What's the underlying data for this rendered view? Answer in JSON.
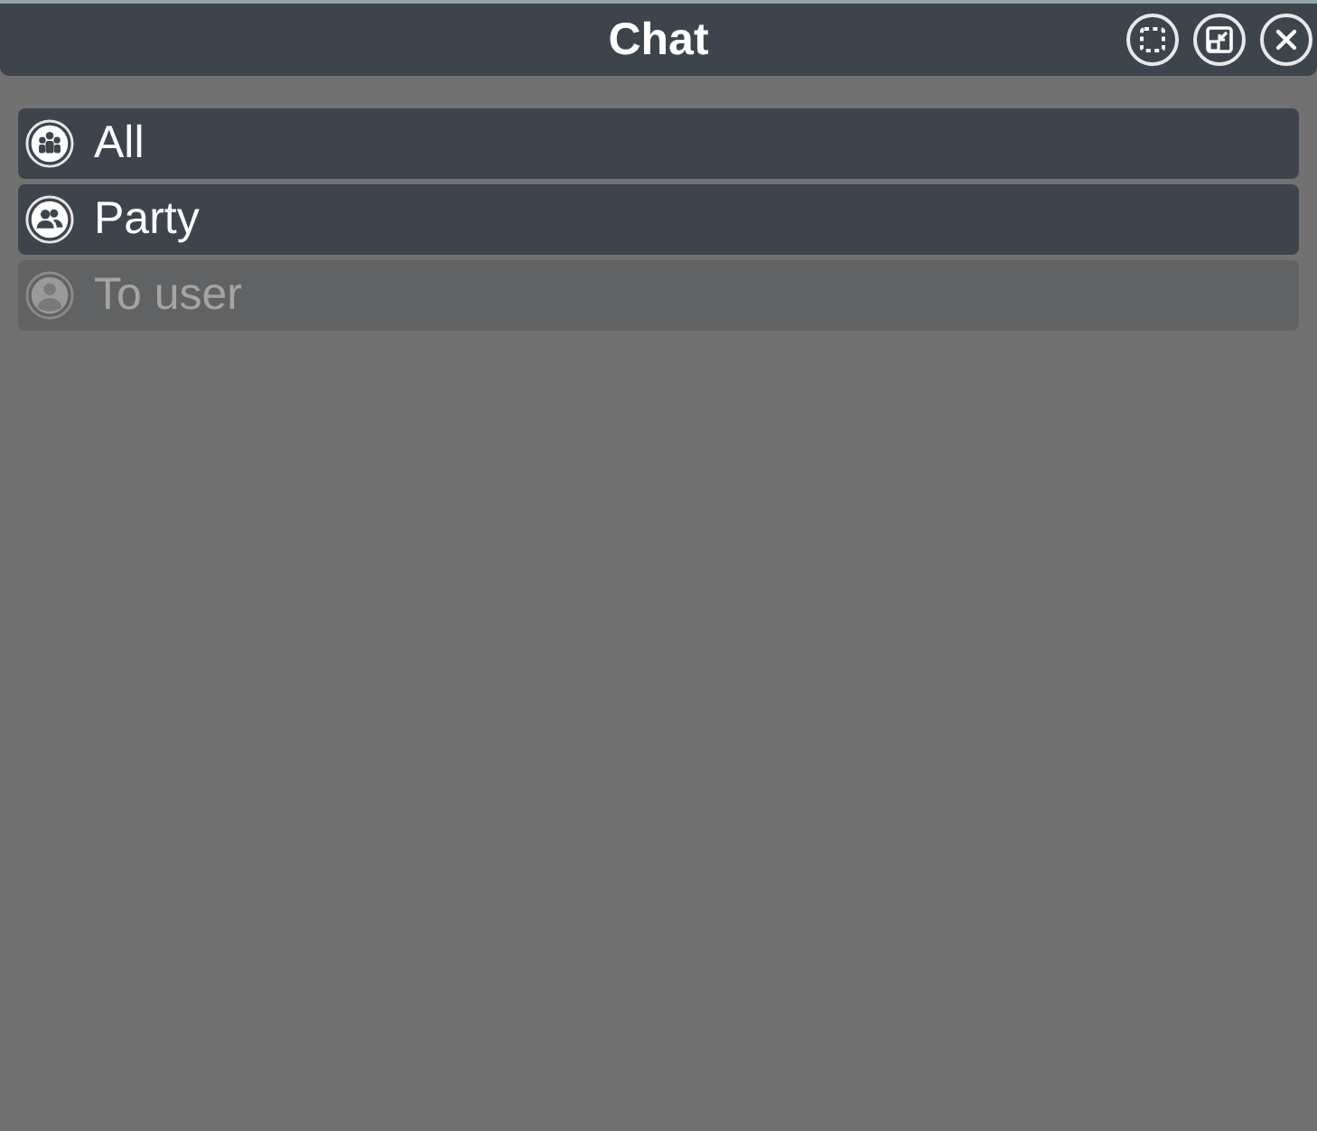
{
  "window": {
    "title": "Chat",
    "buttons": [
      {
        "kind": "select"
      },
      {
        "kind": "shrink"
      },
      {
        "kind": "close"
      }
    ]
  },
  "channels": [
    {
      "label": "All",
      "disabled": false
    },
    {
      "label": "Party",
      "disabled": false
    },
    {
      "label": "To user",
      "disabled": true
    }
  ]
}
